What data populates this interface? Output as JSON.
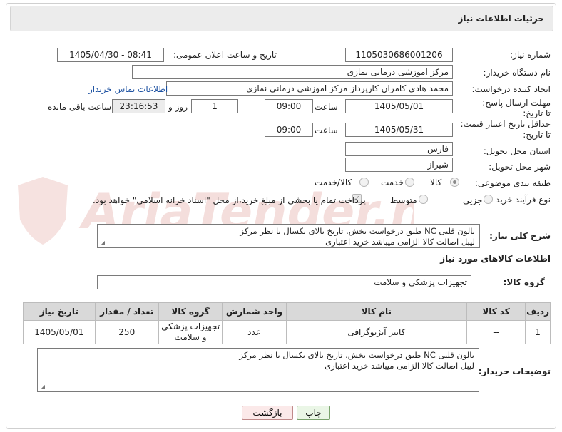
{
  "header": {
    "title": "جزئیات اطلاعات نیاز"
  },
  "form": {
    "need_number_label": "شماره نیاز:",
    "need_number": "1105030686001206",
    "announce_label": "تاریخ و ساعت اعلان عمومی:",
    "announce_value": "1405/04/30 - 08:41",
    "buyer_org_label": "نام دستگاه خریدار:",
    "buyer_org": "مرکز اموزشی درمانی نمازی",
    "creator_label": "ایجاد کننده درخواست:",
    "creator": "محمد هادی کامران کارپرداز مرکز اموزشی درمانی نمازی",
    "contact_link": "اطلاعات تماس خریدار",
    "reply_deadline_label": "مهلت ارسال پاسخ: تا تاریخ:",
    "reply_date": "1405/05/01",
    "time_label": "ساعت",
    "reply_time": "09:00",
    "days_value": "1",
    "days_label": "روز و",
    "remaining_time": "23:16:53",
    "remaining_label": "ساعت باقی مانده",
    "price_deadline_label": "حداقل تاریخ اعتبار قیمت: تا تاریخ:",
    "price_date": "1405/05/31",
    "price_time": "09:00",
    "province_label": "استان محل تحویل:",
    "province": "فارس",
    "city_label": "شهر محل تحویل:",
    "city": "شیراز",
    "category_label": "طبقه بندی موضوعی:",
    "category_options": [
      "کالا",
      "خدمت",
      "کالا/خدمت"
    ],
    "process_label": "نوع فرآیند خرید :",
    "process_options": [
      "جزیی",
      "متوسط"
    ],
    "payment_note": "پرداخت تمام یا بخشی از مبلغ خرید،از محل \"اسناد خزانه اسلامی\" خواهد بود."
  },
  "description": {
    "label": "شرح کلی نیاز:",
    "text": "بالون قلبی NC طبق درخواست بخش. تاریخ بالای یکسال با نظر مرکز\nلیبل اصالت کالا الزامی میباشد خرید اعتباری"
  },
  "goods": {
    "section_title": "اطلاعات کالاهای مورد نیاز",
    "group_label": "گروه کالا:",
    "group_value": "تجهیزات پزشکی و سلامت",
    "columns": [
      "ردیف",
      "کد کالا",
      "نام کالا",
      "واحد شمارش",
      "گروه کالا",
      "تعداد / مقدار",
      "تاریخ نیاز"
    ],
    "rows": [
      {
        "row": "1",
        "code": "--",
        "name": "کاتتر آنژیوگرافی",
        "unit": "عدد",
        "group": "تجهیزات پزشکی و سلامت",
        "qty": "250",
        "date": "1405/05/01"
      }
    ]
  },
  "buyer_notes": {
    "label": "توضیحات خریدار:",
    "text": "بالون قلبی NC طبق درخواست بخش. تاریخ بالای یکسال با نظر مرکز\nلیبل اصالت کالا الزامی میباشد خرید اعتباری"
  },
  "actions": {
    "print": "چاپ",
    "back": "بازگشت"
  },
  "watermark": {
    "text": "AriaTender.net"
  },
  "colors": {
    "header_bg": "#ececec",
    "table_header_bg": "#d9d9d9",
    "link": "#1a4fa0",
    "watermark": "#c0392b"
  }
}
